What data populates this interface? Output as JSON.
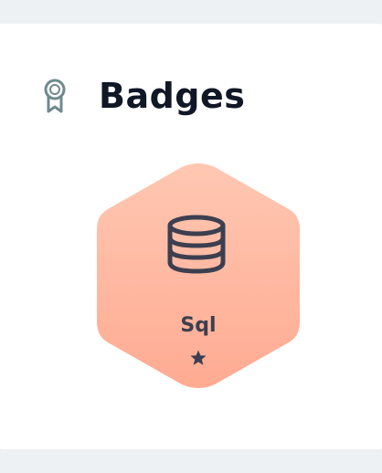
{
  "header": {
    "title": "Badges",
    "icon": "award-ribbon-icon"
  },
  "badges": [
    {
      "label": "Sql",
      "icon": "database-icon",
      "level_icon": "star-icon",
      "stars": 1,
      "color_top": "#ffc4ad",
      "color_bottom": "#ffad94"
    }
  ],
  "colors": {
    "page_background": "#eef1f3",
    "card_background": "#ffffff",
    "title_text": "#101826",
    "header_icon": "#6f8a8f",
    "badge_content": "#3c3f50"
  }
}
